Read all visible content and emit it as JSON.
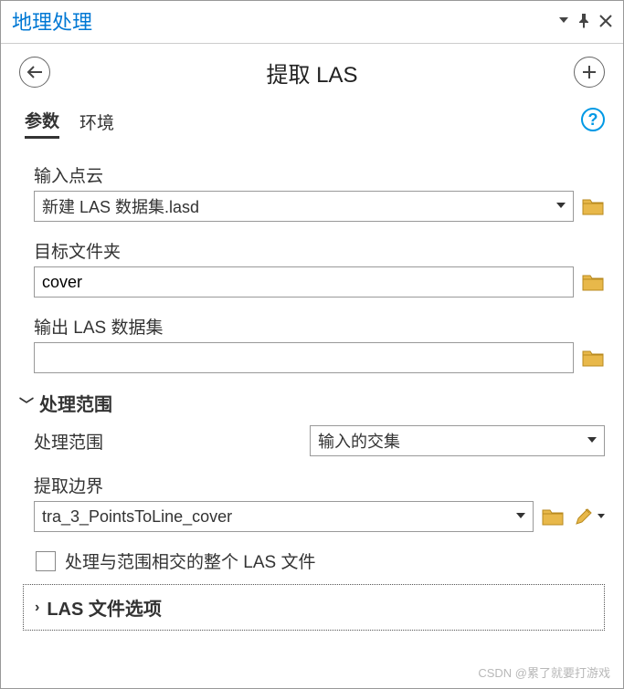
{
  "titlebar": {
    "title": "地理处理"
  },
  "toolbar": {
    "title": "提取 LAS"
  },
  "tabs": {
    "params": "参数",
    "environment": "环境"
  },
  "fields": {
    "input_pointcloud": {
      "label": "输入点云",
      "value": "新建 LAS 数据集.lasd"
    },
    "target_folder": {
      "label": "目标文件夹",
      "value": "cover"
    },
    "output_las": {
      "label": "输出 LAS 数据集",
      "value": ""
    }
  },
  "section_extent": {
    "header": "处理范围",
    "extent_label": "处理范围",
    "extent_value": "输入的交集",
    "boundary_label": "提取边界",
    "boundary_value": "tra_3_PointsToLine_cover",
    "checkbox_label": "处理与范围相交的整个 LAS 文件"
  },
  "section_las_opts": {
    "header": "LAS 文件选项"
  },
  "watermark": "CSDN @累了就要打游戏"
}
